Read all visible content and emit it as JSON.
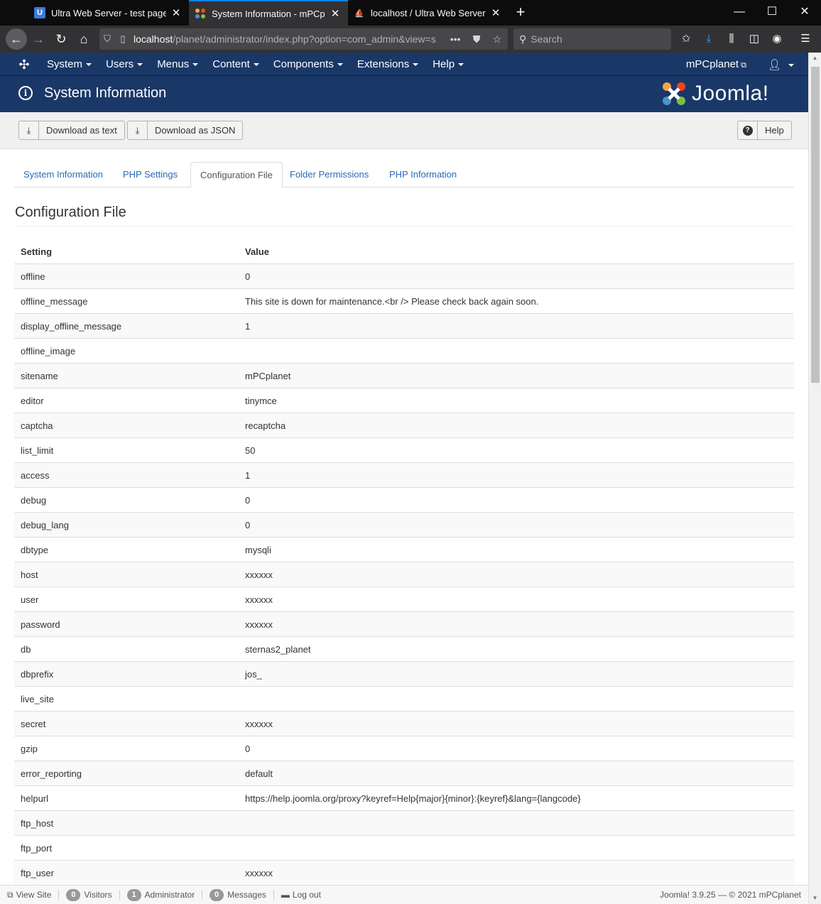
{
  "browser": {
    "tabs": [
      {
        "title": "Ultra Web Server - test page",
        "icon": "ultra-web-server-favicon"
      },
      {
        "title": "System Information - mPCplan",
        "icon": "joomla-favicon",
        "active": true
      },
      {
        "title": "localhost / Ultra Web Server | p",
        "icon": "phpmyadmin-favicon"
      }
    ],
    "url_host": "localhost",
    "url_path": "/planet/administrator/index.php?option=com_admin&view=s",
    "search_placeholder": "Search",
    "icons": {
      "new_tab": "+",
      "minimize": "—",
      "maximize": "☐",
      "close": "✕",
      "back": "←",
      "forward": "→",
      "reload": "↻",
      "home": "⌂"
    }
  },
  "joomla": {
    "menu": [
      "System",
      "Users",
      "Menus",
      "Content",
      "Components",
      "Extensions",
      "Help"
    ],
    "site_link": "mPCplanet",
    "page_title": "System Information",
    "brand": "Joomla!",
    "toolbar": {
      "download_text": "Download as text",
      "download_json": "Download as JSON",
      "help": "Help"
    },
    "tabs": [
      "System Information",
      "PHP Settings",
      "Configuration File",
      "Folder Permissions",
      "PHP Information"
    ],
    "active_tab": "Configuration File",
    "section_title": "Configuration File",
    "table": {
      "headers": [
        "Setting",
        "Value"
      ],
      "rows": [
        [
          "offline",
          "0"
        ],
        [
          "offline_message",
          "This site is down for maintenance.<br /> Please check back again soon."
        ],
        [
          "display_offline_message",
          "1"
        ],
        [
          "offline_image",
          ""
        ],
        [
          "sitename",
          "mPCplanet"
        ],
        [
          "editor",
          "tinymce"
        ],
        [
          "captcha",
          "recaptcha"
        ],
        [
          "list_limit",
          "50"
        ],
        [
          "access",
          "1"
        ],
        [
          "debug",
          "0"
        ],
        [
          "debug_lang",
          "0"
        ],
        [
          "dbtype",
          "mysqli"
        ],
        [
          "host",
          "xxxxxx"
        ],
        [
          "user",
          "xxxxxx"
        ],
        [
          "password",
          "xxxxxx"
        ],
        [
          "db",
          "sternas2_planet"
        ],
        [
          "dbprefix",
          "jos_"
        ],
        [
          "live_site",
          ""
        ],
        [
          "secret",
          "xxxxxx"
        ],
        [
          "gzip",
          "0"
        ],
        [
          "error_reporting",
          "default"
        ],
        [
          "helpurl",
          "https://help.joomla.org/proxy?keyref=Help{major}{minor}:{keyref}&lang={langcode}"
        ],
        [
          "ftp_host",
          ""
        ],
        [
          "ftp_port",
          ""
        ],
        [
          "ftp_user",
          "xxxxxx"
        ]
      ]
    },
    "status": {
      "view_site": "View Site",
      "visitors_count": "0",
      "visitors_label": "Visitors",
      "admin_count": "1",
      "admin_label": "Administrator",
      "messages_count": "0",
      "messages_label": "Messages",
      "logout": "Log out",
      "version": "Joomla! 3.9.25",
      "copyright": "© 2021 mPCplanet"
    }
  }
}
